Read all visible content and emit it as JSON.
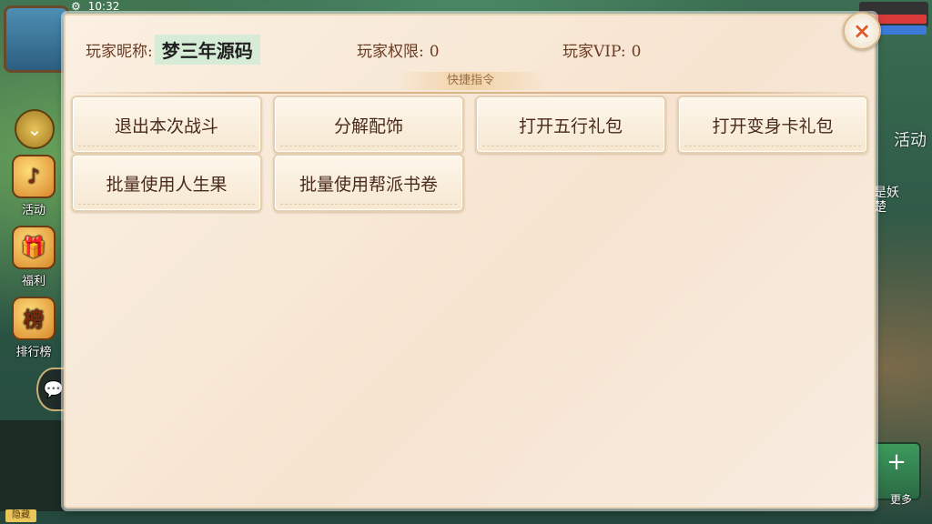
{
  "status_bar": {
    "time": "10:32"
  },
  "left_rail": {
    "activity_label": "活动",
    "welfare_label": "福利",
    "ranking_icon_char": "榜",
    "ranking_label": "排行榜",
    "bottom_tag": "隐藏"
  },
  "right_rail": {
    "activity_label": "活动",
    "side_text": "是妖楚",
    "more_label": "更多"
  },
  "dialog": {
    "nickname_label": "玩家昵称:",
    "nickname_value": "梦三年源码",
    "permission_label": "玩家权限:",
    "permission_value": "0",
    "vip_label": "玩家VIP:",
    "vip_value": "0",
    "section_title": "快捷指令",
    "close_icon": "×",
    "buttons": [
      {
        "label": "退出本次战斗"
      },
      {
        "label": "分解配饰"
      },
      {
        "label": "打开五行礼包"
      },
      {
        "label": "打开变身卡礼包"
      },
      {
        "label": "批量使用人生果"
      },
      {
        "label": "批量使用帮派书卷"
      }
    ]
  },
  "colors": {
    "accent": "#e05a2a",
    "label_text": "#6a3a22",
    "button_text": "#4a2a1a",
    "nickname_bg": "#d7ecd7"
  }
}
